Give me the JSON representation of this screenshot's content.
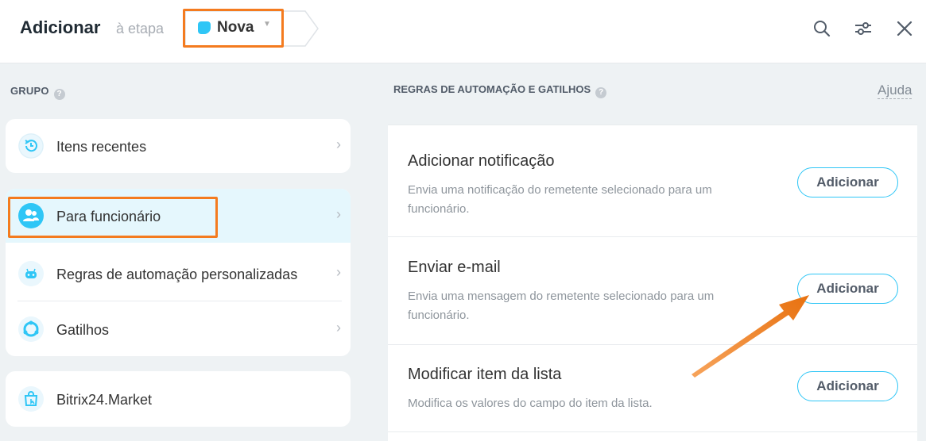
{
  "header": {
    "title": "Adicionar",
    "stage_label": "à etapa",
    "stage_name": "Nova",
    "stage_color": "#2fc6f6",
    "icons": [
      "search-icon",
      "sliders-icon",
      "close-icon"
    ]
  },
  "left": {
    "section_title": "GRUPO",
    "items": [
      {
        "label": "Itens recentes",
        "icon": "history-icon"
      },
      {
        "label": "Para funcionário",
        "icon": "users-icon"
      },
      {
        "label": "Regras de automação personalizadas",
        "icon": "robot-icon"
      },
      {
        "label": "Gatilhos",
        "icon": "trigger-icon"
      },
      {
        "label": "Bitrix24.Market",
        "icon": "market-bag-icon"
      }
    ],
    "chevron": "›"
  },
  "right": {
    "section_title": "REGRAS DE AUTOMAÇÃO E GATILHOS",
    "help_link": "Ajuda",
    "rules": [
      {
        "title": "Adicionar notificação",
        "description": "Envia uma notificação do remetente selecionado para um funcionário.",
        "button": "Adicionar"
      },
      {
        "title": "Enviar e-mail",
        "description": "Envia uma mensagem do remetente selecionado para um funcionário.",
        "button": "Adicionar"
      },
      {
        "title": "Modificar item da lista",
        "description": "Modifica os valores do campo do item da lista.",
        "button": "Adicionar"
      }
    ]
  },
  "colors": {
    "highlight": "#f47b1f",
    "accent": "#2fc6f6",
    "selected_bg": "#e5f7fd"
  }
}
